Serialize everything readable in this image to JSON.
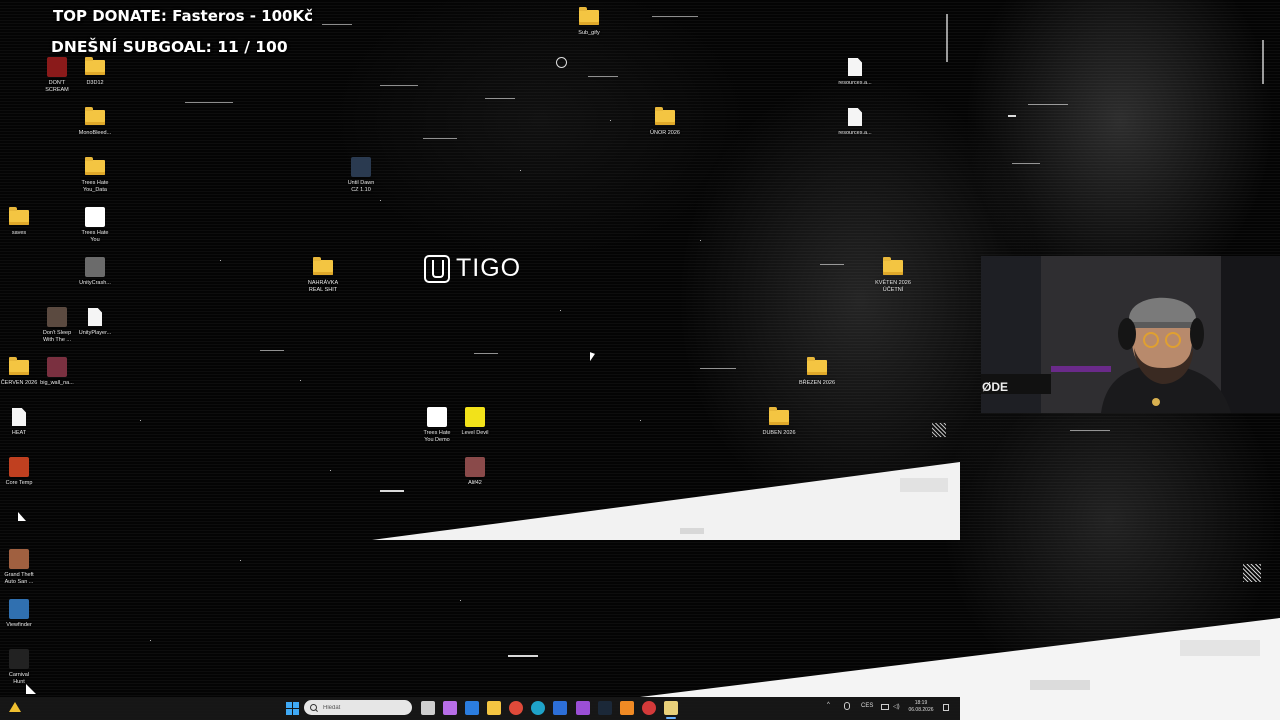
{
  "overlay": {
    "top_donate": "TOP DONATE: Fasteros - 100Kč",
    "subgoal": "DNEŠNÍ SUBGOAL:  11 / 100"
  },
  "logo": {
    "text": "TIGO"
  },
  "desktop_icons": [
    {
      "label": "DON'T\nSCREAM",
      "kind": "app",
      "color": "#8a1a1a"
    },
    {
      "label": "D3D12",
      "kind": "folder"
    },
    {
      "label": "MonoBleed...",
      "kind": "folder"
    },
    {
      "label": "Trees Hate\nYou_Data",
      "kind": "folder"
    },
    {
      "label": "saves",
      "kind": "folder"
    },
    {
      "label": "Trees Hate\nYou",
      "kind": "app",
      "color": "#ffffff"
    },
    {
      "label": "UnityCrash...",
      "kind": "app",
      "color": "#6b6b6b"
    },
    {
      "label": "Don't Sleep\nWith The ...",
      "kind": "app",
      "color": "#5b4a40"
    },
    {
      "label": "UnityPlayer...",
      "kind": "file"
    },
    {
      "label": "ČERVEN 2026",
      "kind": "folder"
    },
    {
      "label": "big_wall_na...",
      "kind": "app",
      "color": "#7a3040"
    },
    {
      "label": "HEAT",
      "kind": "file"
    },
    {
      "label": "Core Temp",
      "kind": "app",
      "color": "#c04020"
    },
    {
      "label": "Grand Theft\nAuto San ...",
      "kind": "app",
      "color": "#a06040"
    },
    {
      "label": "Viewfinder",
      "kind": "app",
      "color": "#3070b0"
    },
    {
      "label": "Carnival\nHunt",
      "kind": "app",
      "color": "#222222"
    },
    {
      "label": "Until Dawn\nCZ 1.10",
      "kind": "app",
      "color": "#2a3a50"
    },
    {
      "label": "NAHRÁVKA\nREAL SHIT",
      "kind": "folder"
    },
    {
      "label": "Sub_gify",
      "kind": "folder"
    },
    {
      "label": "ÚNOR 2026",
      "kind": "folder"
    },
    {
      "label": "resources.a...",
      "kind": "file"
    },
    {
      "label": "resources.a...",
      "kind": "file"
    },
    {
      "label": "KVĚTEN 2026\nÚČETNÍ",
      "kind": "folder"
    },
    {
      "label": "BŘEZEN 2026",
      "kind": "folder"
    },
    {
      "label": "DUBEN 2026",
      "kind": "folder"
    },
    {
      "label": "Trees Hate\nYou Demo",
      "kind": "app",
      "color": "#ffffff"
    },
    {
      "label": "Level Devil",
      "kind": "app",
      "color": "#f2e21a"
    },
    {
      "label": "Alif42",
      "kind": "app",
      "color": "#8a4a4a"
    }
  ],
  "taskbar": {
    "search_placeholder": "Hledat",
    "language": "CES",
    "time": "18:19",
    "date": "06.08.2026",
    "pinned": [
      {
        "name": "task-view-icon",
        "color": "#cfcfcf"
      },
      {
        "name": "copilot-icon",
        "color": "#b86ee8"
      },
      {
        "name": "store-icon",
        "color": "#2b7de0"
      },
      {
        "name": "file-explorer-icon",
        "color": "#f4c542"
      },
      {
        "name": "chrome-icon",
        "color": "#e04a3a"
      },
      {
        "name": "edge-icon",
        "color": "#1fa3c9"
      },
      {
        "name": "app-blue-icon",
        "color": "#2d6fd8"
      },
      {
        "name": "app-purple-icon",
        "color": "#9b4fd6"
      },
      {
        "name": "steam-icon",
        "color": "#1b2838"
      },
      {
        "name": "app-orange-icon",
        "color": "#f08a24"
      },
      {
        "name": "app-red-icon",
        "color": "#d43a3a"
      },
      {
        "name": "app-active-icon",
        "color": "#e8d07a"
      }
    ]
  }
}
